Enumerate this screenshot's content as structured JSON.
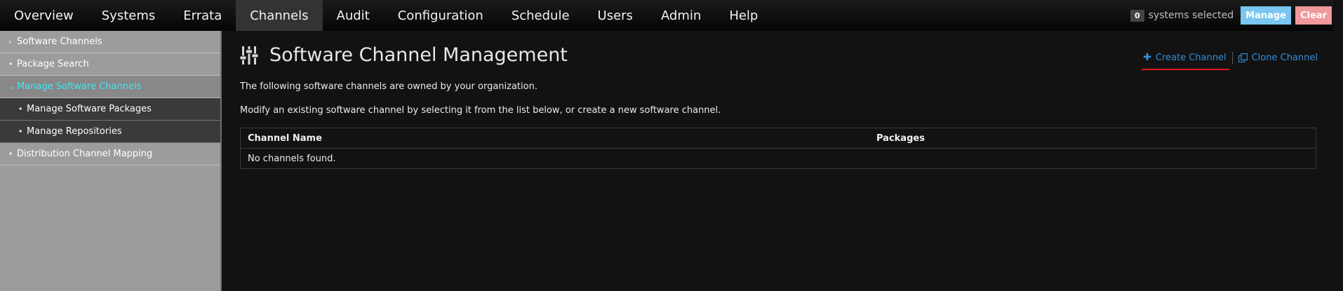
{
  "topnav": {
    "items": [
      {
        "label": "Overview",
        "active": false
      },
      {
        "label": "Systems",
        "active": false
      },
      {
        "label": "Errata",
        "active": false
      },
      {
        "label": "Channels",
        "active": true
      },
      {
        "label": "Audit",
        "active": false
      },
      {
        "label": "Configuration",
        "active": false
      },
      {
        "label": "Schedule",
        "active": false
      },
      {
        "label": "Users",
        "active": false
      },
      {
        "label": "Admin",
        "active": false
      },
      {
        "label": "Help",
        "active": false
      }
    ]
  },
  "ssm": {
    "count": "0",
    "label": "systems selected",
    "manage_label": "Manage",
    "clear_label": "Clear"
  },
  "sidebar": {
    "items": [
      {
        "label": "Software Channels",
        "marker": "›"
      },
      {
        "label": "Package Search",
        "marker": "•"
      },
      {
        "label": "Manage Software Channels",
        "marker": "⌄"
      },
      {
        "label": "Manage Software Packages",
        "marker": "•"
      },
      {
        "label": "Manage Repositories",
        "marker": "•"
      },
      {
        "label": "Distribution Channel Mapping",
        "marker": "•"
      }
    ]
  },
  "main": {
    "title": "Software Channel Management",
    "icon": "sliders-icon",
    "actions": {
      "create_label": "Create Channel",
      "clone_label": "Clone Channel"
    },
    "intro": "The following software channels are owned by your organization.",
    "instructions": "Modify an existing software channel by selecting it from the list below, or create a new software channel.",
    "table": {
      "headers": [
        "Channel Name",
        "Packages"
      ],
      "empty_message": "No channels found."
    }
  },
  "colors": {
    "accent_link": "#2f8fdd",
    "expanded_item": "#3fe6f3",
    "manage_button": "#79c6f0",
    "clear_button": "#f0989b",
    "underline": "#e0161b"
  }
}
